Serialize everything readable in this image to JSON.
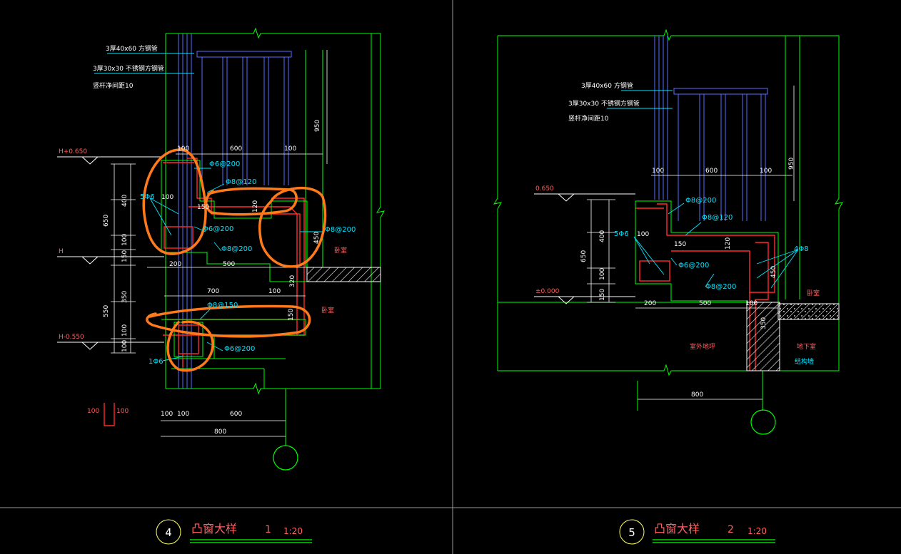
{
  "colors": {
    "background": "#000000",
    "outline": "#00ff00",
    "rail": "#5a6cff",
    "rebar": "#ff2a2a",
    "dimension": "#ffffff",
    "leader": "#00e5ff",
    "elevation": "#ff6060",
    "markup": "#ff7a1a",
    "frame": "#9a9a9a",
    "hatch": "#ffffff"
  },
  "detail1": {
    "note_tube": "3厚40x60  方钢管",
    "note_rail": "3厚30x30  不锈钢方钢管",
    "note_spacing": "竖杆净间距10",
    "dims": {
      "h950": "950",
      "top100a": "100",
      "top600": "600",
      "top100b": "100",
      "v650": "650",
      "v400": "400",
      "v100a": "100",
      "v150": "150",
      "v350": "350",
      "v550": "550",
      "v100b": "100",
      "v100c": "100",
      "h200": "200",
      "h500": "500",
      "h700": "700",
      "h100": "100",
      "v120": "120",
      "v450": "450",
      "v320": "320",
      "v150b": "150",
      "b100a": "100",
      "b100b": "100",
      "b600": "600",
      "b800": "800",
      "s100": "100",
      "s150": "150",
      "inset100": "100",
      "sym100a": "100",
      "sym100b": "100"
    },
    "elev_top": "H+0.650",
    "elev_mid": "H",
    "elev_bot": "H-0.550",
    "rebar": {
      "r1": "Φ6@200",
      "r2": "Φ8@120",
      "r3": "5Φ6",
      "r4": "Φ6@200",
      "r5": "Φ8@200",
      "r6": "Φ8@200",
      "r7": "Φ8@150",
      "r8": "Φ6@200",
      "r9": "1Φ6"
    },
    "room_a": "卧室",
    "room_b": "卧室"
  },
  "detail2": {
    "note_tube": "3厚40x60  方钢管",
    "note_rail": "3厚30x30  不锈钢方钢管",
    "note_spacing": "竖杆净间距10",
    "dims": {
      "h950": "950",
      "top100a": "100",
      "top600": "600",
      "top100b": "100",
      "v650": "650",
      "v400": "400",
      "v100": "100",
      "v150": "150",
      "h200": "200",
      "h500": "500",
      "h100": "100",
      "v120": "120",
      "v450": "450",
      "v350": "350",
      "b800": "800",
      "s100": "100",
      "s150": "150"
    },
    "elev_top": "0.650",
    "elev_bot": "±0.000",
    "rebar": {
      "r1": "Φ8@200",
      "r2": "Φ8@120",
      "r3": "5Φ6",
      "r4": "Φ6@200",
      "r5": "Φ8@200",
      "r6": "4Φ8"
    },
    "room": "卧室",
    "ground": "室外地坪",
    "basement": "地下室",
    "wall": "结构墙"
  },
  "titles": {
    "t1": {
      "num": "4",
      "name": "凸窗大样",
      "idx": "1",
      "scale": "1:20"
    },
    "t2": {
      "num": "5",
      "name": "凸窗大样",
      "idx": "2",
      "scale": "1:20"
    }
  }
}
